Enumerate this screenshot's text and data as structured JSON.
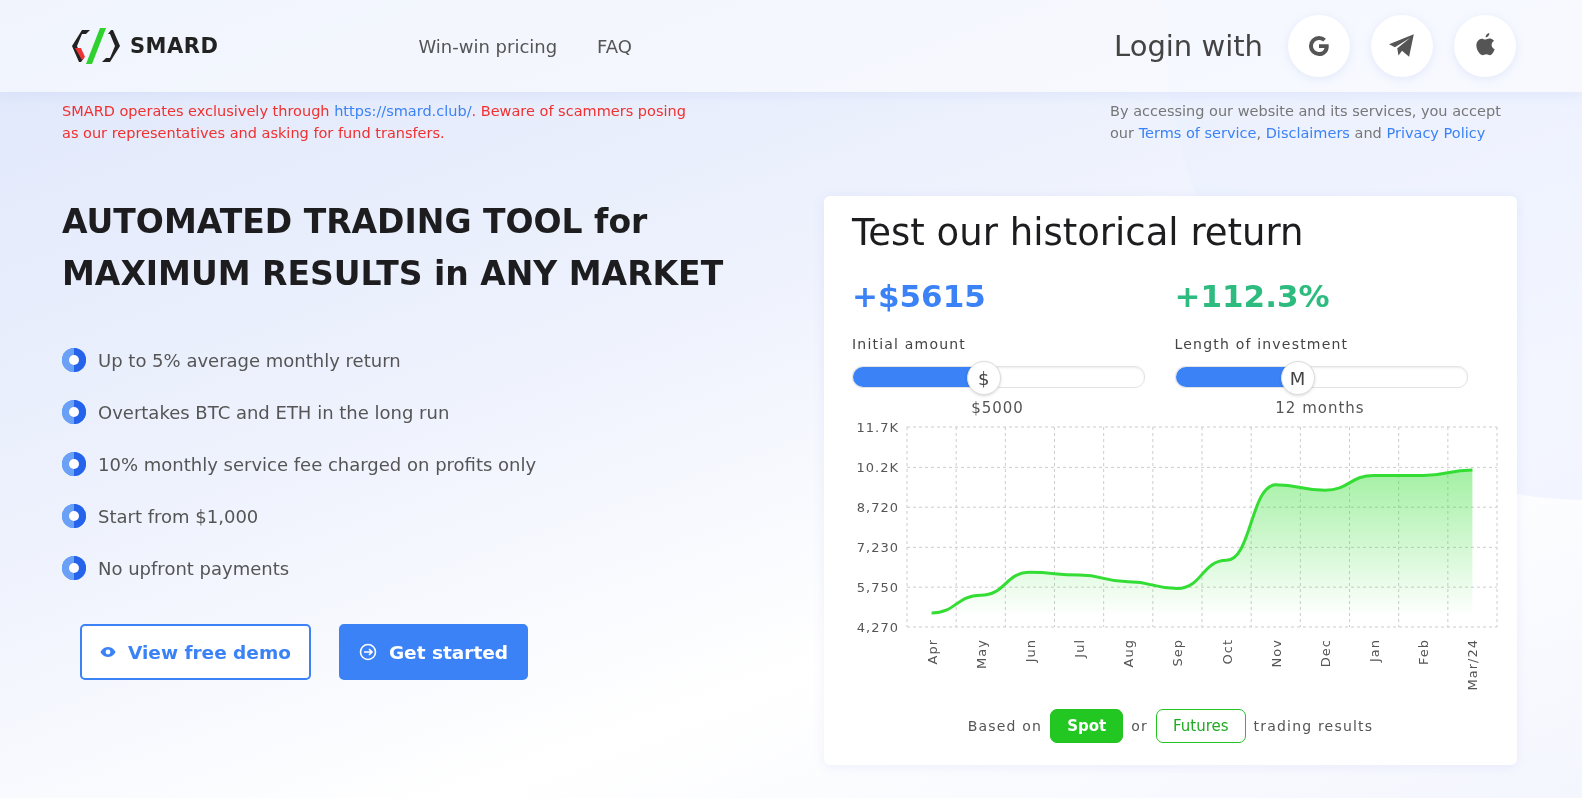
{
  "header": {
    "brand": "SMARD",
    "nav": [
      {
        "label": "Win-win pricing"
      },
      {
        "label": "FAQ"
      }
    ],
    "login_label": "Login with",
    "login_buttons": [
      {
        "kind": "google"
      },
      {
        "kind": "telegram"
      },
      {
        "kind": "apple"
      }
    ]
  },
  "notice": {
    "parts": [
      {
        "kind": "text",
        "text": "SMARD operates exclusively through "
      },
      {
        "kind": "link",
        "text": "https://smard.club/"
      },
      {
        "kind": "text",
        "text": ". Beware of scammers posing as our representatives and asking for fund transfers."
      }
    ]
  },
  "terms": {
    "parts": [
      {
        "kind": "text",
        "text": "By accessing our website and its services, you accept our "
      },
      {
        "kind": "link",
        "text": "Terms of service"
      },
      {
        "kind": "text",
        "text": ", "
      },
      {
        "kind": "link",
        "text": "Disclaimers"
      },
      {
        "kind": "text",
        "text": " and "
      },
      {
        "kind": "link",
        "text": "Privacy Policy"
      }
    ]
  },
  "hero": {
    "title_lines": [
      "AUTOMATED TRADING TOOL for",
      "MAXIMUM RESULTS in ANY MARKET"
    ],
    "features": [
      "Up to 5% average monthly return",
      "Overtakes BTC and ETH in the long run",
      "10% monthly service fee charged on profits only",
      "Start from $1,000",
      "No upfront payments"
    ],
    "buttons": [
      {
        "kind": "outline",
        "label": "View free demo"
      },
      {
        "kind": "primary",
        "label": "Get started"
      }
    ]
  },
  "calculator": {
    "title": "Test our historical return",
    "profit": "+$5615",
    "percent": "+112.3%",
    "sliders": [
      {
        "label": "Initial amount",
        "thumb": "$",
        "level": 0.45,
        "reading": "$5000"
      },
      {
        "label": "Length of investment",
        "thumb": "M",
        "level": 0.42,
        "reading": "12 months"
      }
    ],
    "chart_data": {
      "type": "area",
      "categories": [
        "Apr",
        "May",
        "Jun",
        "Jul",
        "Aug",
        "Sep",
        "Oct",
        "Nov",
        "Dec",
        "Jan",
        "Feb",
        "Mar/24"
      ],
      "series": [
        {
          "color": "#33dd33",
          "values": [
            4790,
            5450,
            6300,
            6200,
            5950,
            5700,
            6750,
            9550,
            9350,
            9900,
            9900,
            10100
          ]
        }
      ],
      "grid": true,
      "ylim": [
        4270,
        11700
      ],
      "yticks": [
        {
          "value": 4270,
          "label": "4,270"
        },
        {
          "value": 5750,
          "label": "5,750"
        },
        {
          "value": 7230,
          "label": "7,230"
        },
        {
          "value": 8720,
          "label": "8,720"
        },
        {
          "value": 10200,
          "label": "10.2K"
        },
        {
          "value": 11700,
          "label": "11.7K"
        }
      ]
    },
    "basis": {
      "prefix": "Based on",
      "joiner": "or",
      "suffix": "trading results",
      "options": [
        {
          "label": "Spot",
          "selected": true
        },
        {
          "label": "Futures",
          "selected": false
        }
      ]
    }
  }
}
